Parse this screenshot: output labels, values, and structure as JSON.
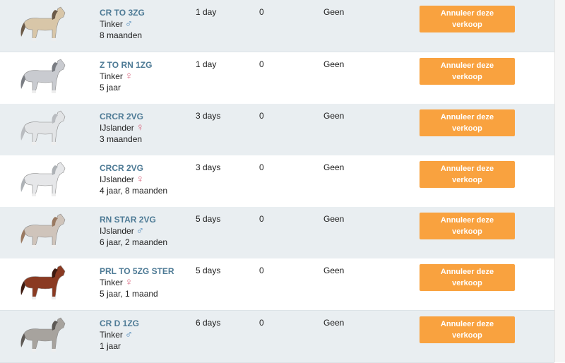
{
  "colors": {
    "button": "#f9a23f",
    "name_link": "#4d7a95",
    "male": "#4a86b8",
    "female": "#d9667f",
    "alt_row": "#e9eef1"
  },
  "rows": [
    {
      "name": "CR TO 3ZG",
      "breed": "Tinker",
      "gender": "♂",
      "gender_icon": "male-icon",
      "age": "8 maanden",
      "days": "1 day",
      "bids": "0",
      "bid": "Geen",
      "button": "Annuleer deze verkoop",
      "horse_color": "#d8c6a8",
      "mane_color": "#6b5a48"
    },
    {
      "name": "Z TO RN 1ZG",
      "breed": "Tinker",
      "gender": "♀",
      "gender_icon": "female-icon",
      "age": "5 jaar",
      "days": "1 day",
      "bids": "0",
      "bid": "Geen",
      "button": "Annuleer deze verkoop",
      "horse_color": "#c9cbd0",
      "mane_color": "#7a7d83"
    },
    {
      "name": "CRCR 2VG",
      "breed": "IJslander",
      "gender": "♀",
      "gender_icon": "female-icon",
      "age": "3 maanden",
      "days": "3 days",
      "bids": "0",
      "bid": "Geen",
      "button": "Annuleer deze verkoop",
      "horse_color": "#e2e4e6",
      "mane_color": "#b9bcc0"
    },
    {
      "name": "CRCR 2VG",
      "breed": "IJslander",
      "gender": "♀",
      "gender_icon": "female-icon",
      "age": "4 jaar, 8 maanden",
      "days": "3 days",
      "bids": "0",
      "bid": "Geen",
      "button": "Annuleer deze verkoop",
      "horse_color": "#e6e7e9",
      "mane_color": "#aeb2b6"
    },
    {
      "name": "RN STAR 2VG",
      "breed": "IJslander",
      "gender": "♂",
      "gender_icon": "male-icon",
      "age": "6 jaar, 2 maanden",
      "days": "5 days",
      "bids": "0",
      "bid": "Geen",
      "button": "Annuleer deze verkoop",
      "horse_color": "#cfc4bb",
      "mane_color": "#9a7a62"
    },
    {
      "name": "PRL TO 5ZG STER",
      "breed": "Tinker",
      "gender": "♀",
      "gender_icon": "female-icon",
      "age": "5 jaar, 1 maand",
      "days": "5 days",
      "bids": "0",
      "bid": "Geen",
      "button": "Annuleer deze verkoop",
      "horse_color": "#8a3a22",
      "mane_color": "#3e1a10"
    },
    {
      "name": "CR D 1ZG",
      "breed": "Tinker",
      "gender": "♂",
      "gender_icon": "male-icon",
      "age": "1 jaar",
      "days": "6 days",
      "bids": "0",
      "bid": "Geen",
      "button": "Annuleer deze verkoop",
      "horse_color": "#a7a39e",
      "mane_color": "#5e5a56"
    }
  ]
}
